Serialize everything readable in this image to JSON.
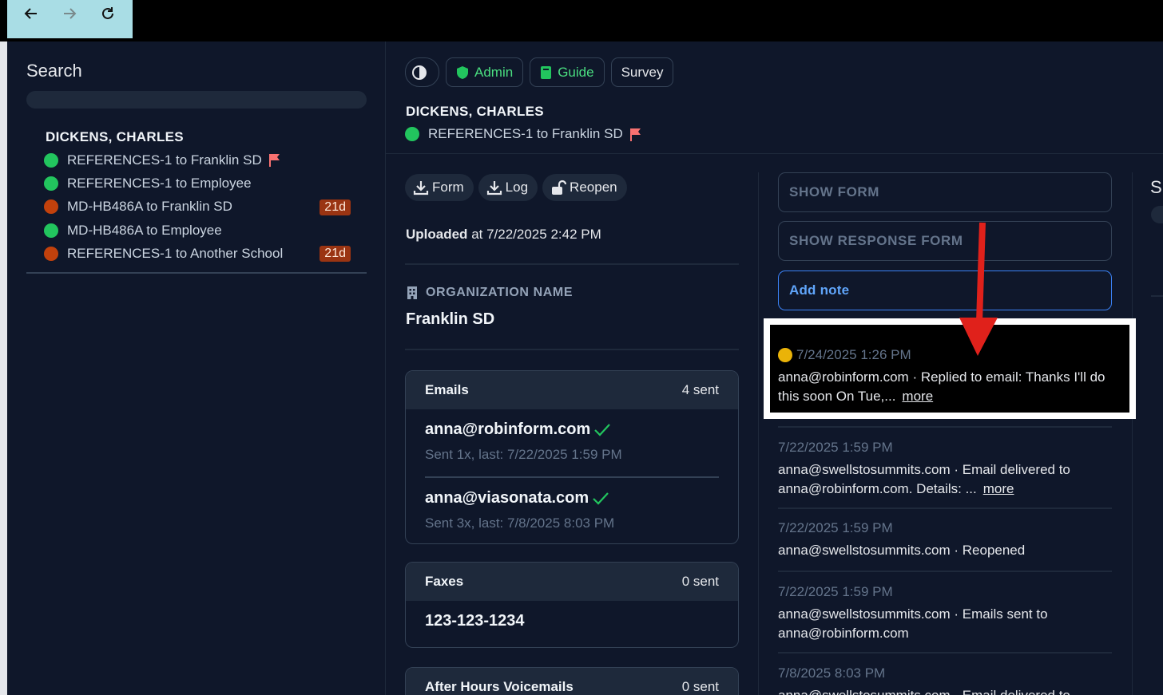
{
  "browser": {
    "back_icon": "arrow-left-icon",
    "forward_icon": "arrow-right-icon",
    "reload_icon": "reload-icon"
  },
  "sidebar": {
    "search_label": "Search",
    "search_placeholder": "",
    "person_name": "DICKENS, CHARLES",
    "items": [
      {
        "label": "REFERENCES-1 to Franklin SD",
        "status": "green",
        "flag": true,
        "badge": ""
      },
      {
        "label": "REFERENCES-1 to Employee",
        "status": "green",
        "flag": false,
        "badge": ""
      },
      {
        "label": "MD-HB486A to Franklin SD",
        "status": "brown",
        "flag": false,
        "badge": "21d"
      },
      {
        "label": "MD-HB486A to Employee",
        "status": "green",
        "flag": false,
        "badge": ""
      },
      {
        "label": "REFERENCES-1 to Another School",
        "status": "brown",
        "flag": false,
        "badge": "21d"
      }
    ]
  },
  "header": {
    "theme_icon": "contrast-icon",
    "admin_label": "Admin",
    "guide_label": "Guide",
    "survey_label": "Survey",
    "person_name": "DICKENS, CHARLES",
    "request_label": "REFERENCES-1 to Franklin SD"
  },
  "actions": {
    "form_label": "Form",
    "log_label": "Log",
    "reopen_label": "Reopen"
  },
  "upload": {
    "prefix": "Uploaded",
    "suffix": "at 7/22/2025 2:42 PM"
  },
  "organization": {
    "label": "ORGANIZATION NAME",
    "value": "Franklin SD"
  },
  "emails": {
    "title": "Emails",
    "count": "4 sent",
    "entries": [
      {
        "address": "anna@robinform.com",
        "meta": "Sent 1x, last: 7/22/2025 1:59 PM"
      },
      {
        "address": "anna@viasonata.com",
        "meta": "Sent 3x, last: 7/8/2025 8:03 PM"
      }
    ]
  },
  "faxes": {
    "title": "Faxes",
    "count": "0 sent",
    "number": "123-123-1234"
  },
  "voicemails": {
    "title": "After Hours Voicemails",
    "count": "0 sent"
  },
  "right_panel": {
    "show_form": "SHOW FORM",
    "show_response_form": "SHOW RESPONSE FORM",
    "add_note": "Add note",
    "more_label": "more",
    "timeline": [
      {
        "date": "7/24/2025 1:26 PM",
        "text": "anna@robinform.com · Replied to email: Thanks I'll do this soon On Tue,...",
        "more": true,
        "highlight": true
      },
      {
        "date": "7/22/2025 1:59 PM",
        "text": "anna@swellstosummits.com · Email delivered to anna@robinform.com. Details: ...",
        "more": true,
        "highlight": false
      },
      {
        "date": "7/22/2025 1:59 PM",
        "text": "anna@swellstosummits.com · Reopened",
        "more": false,
        "highlight": false
      },
      {
        "date": "7/22/2025 1:59 PM",
        "text": "anna@swellstosummits.com · Emails sent to anna@robinform.com",
        "more": false,
        "highlight": false
      },
      {
        "date": "7/8/2025 8:03 PM",
        "text": "anna@swellstosummits.com · Email delivered to",
        "more": false,
        "highlight": false
      }
    ],
    "right_edge_letter": "S"
  },
  "colors": {
    "background": "#0f172a",
    "accent_green": "#22c55e",
    "accent_brown": "#c2410c",
    "link_blue": "#60a5fa",
    "annotation_red": "#e0211b"
  }
}
